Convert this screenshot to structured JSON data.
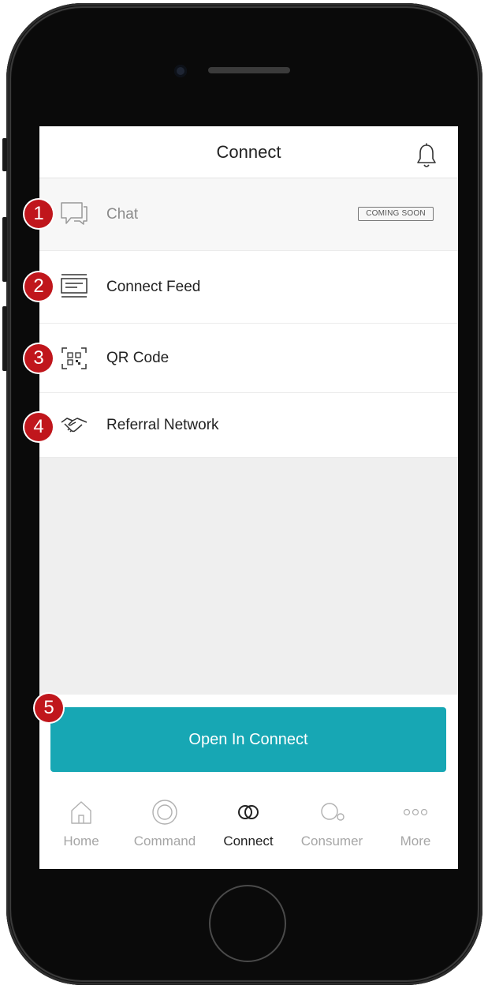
{
  "header": {
    "title": "Connect",
    "bell_icon": "bell-icon"
  },
  "menu": [
    {
      "label": "Chat",
      "icon": "chat-bubble-icon",
      "badge": "COMING SOON",
      "marker": "1"
    },
    {
      "label": "Connect Feed",
      "icon": "feed-icon",
      "marker": "2"
    },
    {
      "label": "QR Code",
      "icon": "qr-code-icon",
      "marker": "3"
    },
    {
      "label": "Referral Network",
      "icon": "handshake-icon",
      "marker": "4"
    }
  ],
  "cta": {
    "label": "Open In Connect",
    "marker": "5"
  },
  "tabs": [
    {
      "label": "Home",
      "icon": "home-icon"
    },
    {
      "label": "Command",
      "icon": "command-target-icon"
    },
    {
      "label": "Connect",
      "icon": "connect-rings-icon",
      "active": true
    },
    {
      "label": "Consumer",
      "icon": "consumer-icon"
    },
    {
      "label": "More",
      "icon": "more-dots-icon"
    }
  ],
  "colors": {
    "accent": "#17a7b4",
    "marker": "#c0161c",
    "inactive_tab": "#a6a6a6",
    "active_tab": "#222222",
    "empty_background": "#efefef"
  }
}
